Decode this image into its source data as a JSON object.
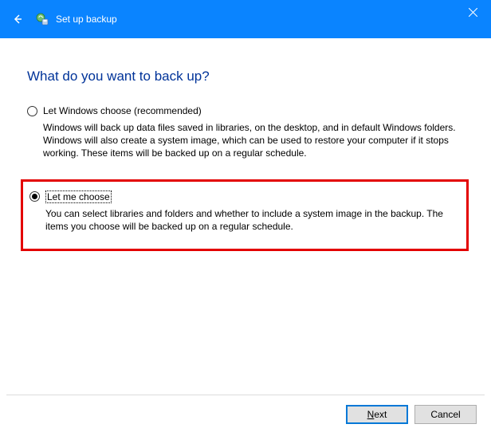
{
  "titlebar": {
    "title": "Set up backup"
  },
  "heading": "What do you want to back up?",
  "options": {
    "auto": {
      "label": "Let Windows choose (recommended)",
      "desc": "Windows will back up data files saved in libraries, on the desktop, and in default Windows folders. Windows will also create a system image, which can be used to restore your computer if it stops working. These items will be backed up on a regular schedule.",
      "selected": false
    },
    "manual": {
      "label": "Let me choose",
      "desc": "You can select libraries and folders and whether to include a system image in the backup. The items you choose will be backed up on a regular schedule.",
      "selected": true
    }
  },
  "buttons": {
    "next": "Next",
    "cancel": "Cancel"
  }
}
